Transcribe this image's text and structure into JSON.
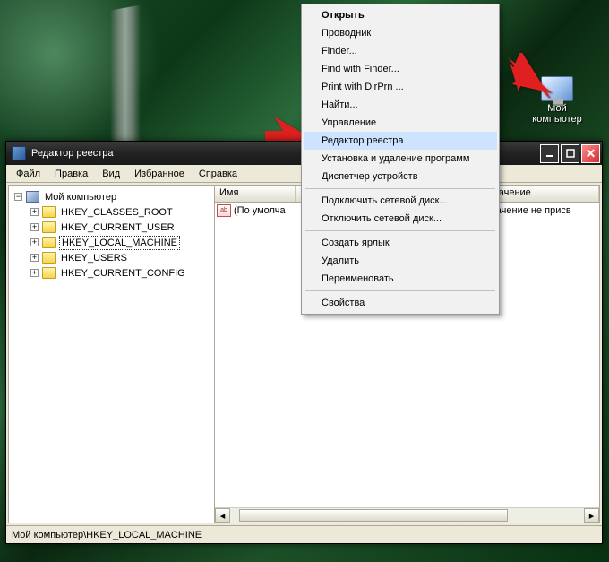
{
  "desktop": {
    "icon_label": "Мой компьютер"
  },
  "window": {
    "title": "Редактор реестра",
    "menus": [
      "Файл",
      "Правка",
      "Вид",
      "Избранное",
      "Справка"
    ],
    "statusbar": "Мой компьютер\\HKEY_LOCAL_MACHINE"
  },
  "tree": {
    "root": "Мой компьютер",
    "items": [
      "HKEY_CLASSES_ROOT",
      "HKEY_CURRENT_USER",
      "HKEY_LOCAL_MACHINE",
      "HKEY_USERS",
      "HKEY_CURRENT_CONFIG"
    ],
    "selected_index": 2
  },
  "list": {
    "columns": [
      "Имя",
      "",
      "Значение"
    ],
    "rows": [
      {
        "name": "(По умолча",
        "value": "(значение не присв"
      }
    ]
  },
  "context_menu": {
    "groups": [
      [
        {
          "label": "Открыть",
          "bold": true
        },
        {
          "label": "Проводник"
        },
        {
          "label": "Finder..."
        },
        {
          "label": "Find with Finder..."
        },
        {
          "label": "Print with DirPrn ..."
        },
        {
          "label": "Найти..."
        },
        {
          "label": "Управление"
        },
        {
          "label": "Редактор реестра",
          "highlight": true
        },
        {
          "label": "Установка и удаление программ"
        },
        {
          "label": "Диспетчер устройств"
        }
      ],
      [
        {
          "label": "Подключить сетевой диск..."
        },
        {
          "label": "Отключить сетевой диск..."
        }
      ],
      [
        {
          "label": "Создать ярлык"
        },
        {
          "label": "Удалить"
        },
        {
          "label": "Переименовать"
        }
      ],
      [
        {
          "label": "Свойства"
        }
      ]
    ]
  }
}
